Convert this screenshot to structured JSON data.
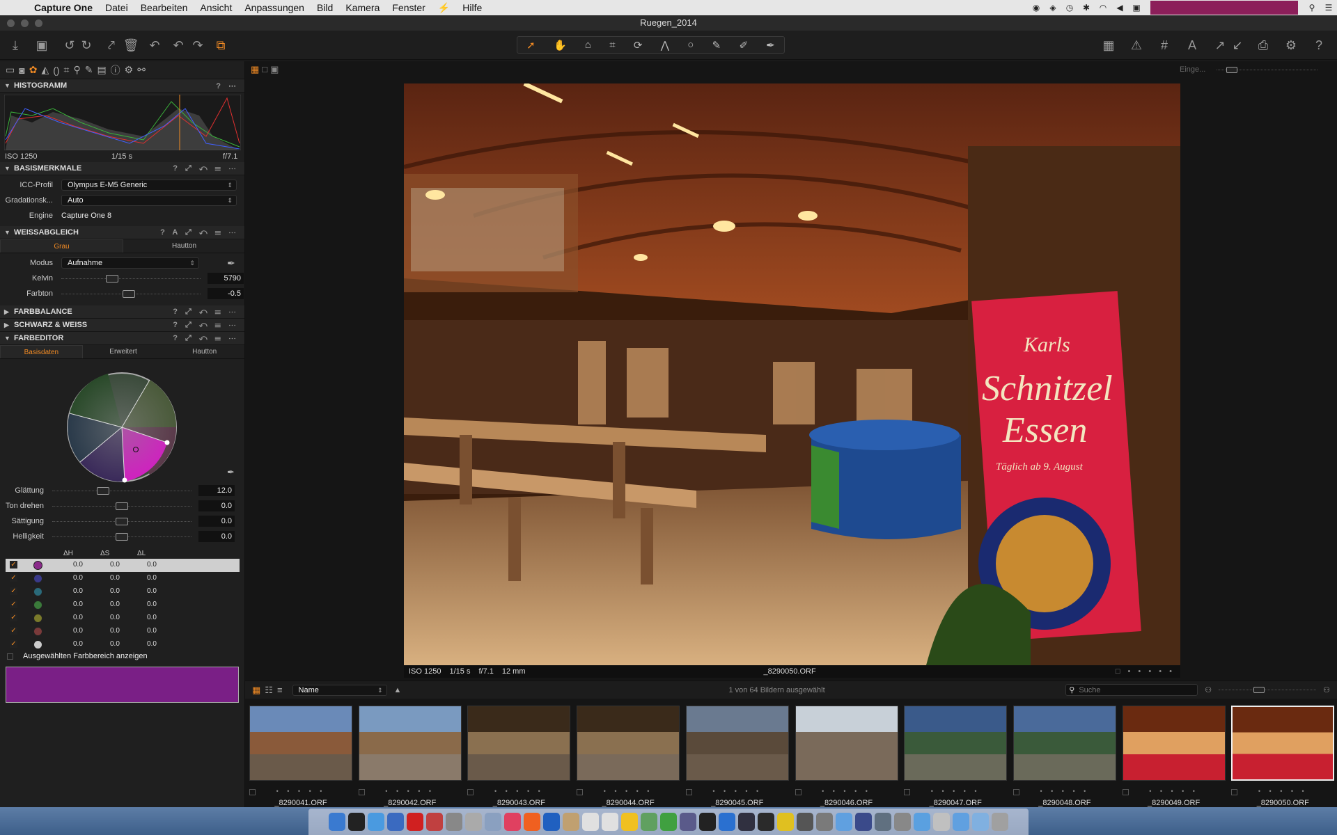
{
  "menubar": {
    "apple_icon": "apple-icon",
    "app_name": "Capture One",
    "items": [
      "Datei",
      "Bearbeiten",
      "Ansicht",
      "Anpassungen",
      "Bild",
      "Kamera",
      "Fenster",
      "⚡",
      "Hilfe"
    ]
  },
  "window": {
    "title": "Ruegen_2014"
  },
  "panels": {
    "histogram": {
      "title": "HISTOGRAMM",
      "iso": "ISO 1250",
      "shutter": "1/15 s",
      "aperture": "f/7.1"
    },
    "basic": {
      "title": "BASISMERKMALE",
      "icc_label": "ICC-Profil",
      "icc_value": "Olympus E-M5 Generic",
      "curve_label": "Gradationsk...",
      "curve_value": "Auto",
      "engine_label": "Engine",
      "engine_value": "Capture One 8"
    },
    "wb": {
      "title": "WEISSABGLEICH",
      "tab1": "Grau",
      "tab2": "Hautton",
      "mode_label": "Modus",
      "mode_value": "Aufnahme",
      "kelvin_label": "Kelvin",
      "kelvin_value": "5790",
      "tint_label": "Farbton",
      "tint_value": "-0.5"
    },
    "collapsed": [
      "FARBBALANCE",
      "SCHWARZ & WEISS"
    ],
    "coloreditor": {
      "title": "FARBEDITOR",
      "tabs": [
        "Basisdaten",
        "Erweitert",
        "Hautton"
      ],
      "sliders": [
        {
          "label": "Glättung",
          "value": "12.0"
        },
        {
          "label": "Ton drehen",
          "value": "0.0"
        },
        {
          "label": "Sättigung",
          "value": "0.0"
        },
        {
          "label": "Helligkeit",
          "value": "0.0"
        }
      ],
      "col_headers": [
        "ΔH",
        "ΔS",
        "ΔL"
      ],
      "rows": [
        {
          "color": "#8a2a8a",
          "dh": "0.0",
          "ds": "0.0",
          "dl": "0.0"
        },
        {
          "color": "#3a3a8a",
          "dh": "0.0",
          "ds": "0.0",
          "dl": "0.0"
        },
        {
          "color": "#2a6a7a",
          "dh": "0.0",
          "ds": "0.0",
          "dl": "0.0"
        },
        {
          "color": "#3a7a3a",
          "dh": "0.0",
          "ds": "0.0",
          "dl": "0.0"
        },
        {
          "color": "#7a7a2a",
          "dh": "0.0",
          "ds": "0.0",
          "dl": "0.0"
        },
        {
          "color": "#7a3a3a",
          "dh": "0.0",
          "ds": "0.0",
          "dl": "0.0"
        },
        {
          "color": "#cccccc",
          "dh": "0.0",
          "ds": "0.0",
          "dl": "0.0"
        }
      ],
      "show_range_label": "Ausgewählten Farbbereich anzeigen",
      "swatch_color": "#7a1f86"
    }
  },
  "viewer": {
    "iso": "ISO 1250",
    "shutter": "1/15 s",
    "aperture": "f/7.1",
    "focal": "12 mm",
    "filename": "_8290050.ORF",
    "sign": {
      "brand": "Karls",
      "line1": "Schnitzel",
      "line2": "Essen",
      "sub": "Täglich ab 9. August"
    }
  },
  "toprightlabel": "Einge...",
  "browser": {
    "sort_label": "Name",
    "selection_text": "1 von 64 Bildern ausgewählt",
    "search_placeholder": "Suche",
    "thumbs": [
      "_8290041.ORF",
      "_8290042.ORF",
      "_8290043.ORF",
      "_8290044.ORF",
      "_8290045.ORF",
      "_8290046.ORF",
      "_8290047.ORF",
      "_8290048.ORF",
      "_8290049.ORF",
      "_8290050.ORF"
    ]
  },
  "colors": {
    "accent": "#f08a24",
    "selection_magenta": "#8c1f5a"
  }
}
